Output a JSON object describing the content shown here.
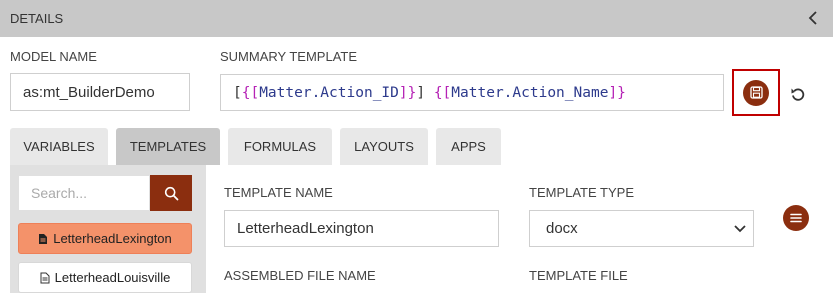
{
  "header": {
    "title": "DETAILS"
  },
  "model": {
    "label": "MODEL NAME",
    "value": "as:mt_BuilderDemo"
  },
  "summary": {
    "label": "SUMMARY TEMPLATE",
    "tokens": [
      "[",
      "{[",
      "Matter.Action_ID",
      "]}",
      "] ",
      "{[",
      "Matter.Action_Name",
      "]}"
    ]
  },
  "tabs": [
    "VARIABLES",
    "TEMPLATES",
    "FORMULAS",
    "LAYOUTS",
    "APPS"
  ],
  "active_tab": "TEMPLATES",
  "search": {
    "placeholder": "Search..."
  },
  "templates": [
    {
      "name": "LetterheadLexington",
      "active": true
    },
    {
      "name": "LetterheadLouisville",
      "active": false
    }
  ],
  "form": {
    "template_name_label": "TEMPLATE NAME",
    "template_name_value": "LetterheadLexington",
    "template_type_label": "TEMPLATE TYPE",
    "template_type_value": "docx",
    "assembled_file_name_label": "ASSEMBLED FILE NAME",
    "template_file_label": "TEMPLATE FILE"
  },
  "colors": {
    "accent": "#8b2e0f",
    "highlight_border": "#c00000",
    "active_item": "#f4926a",
    "header_bg": "#c8c8c8",
    "token_brace": "#b521b5",
    "token_name": "#2d3a8c"
  },
  "icons": [
    "chevron-left-icon",
    "save-icon",
    "undo-icon",
    "search-icon",
    "file-icon",
    "chevron-down-icon",
    "menu-icon"
  ]
}
